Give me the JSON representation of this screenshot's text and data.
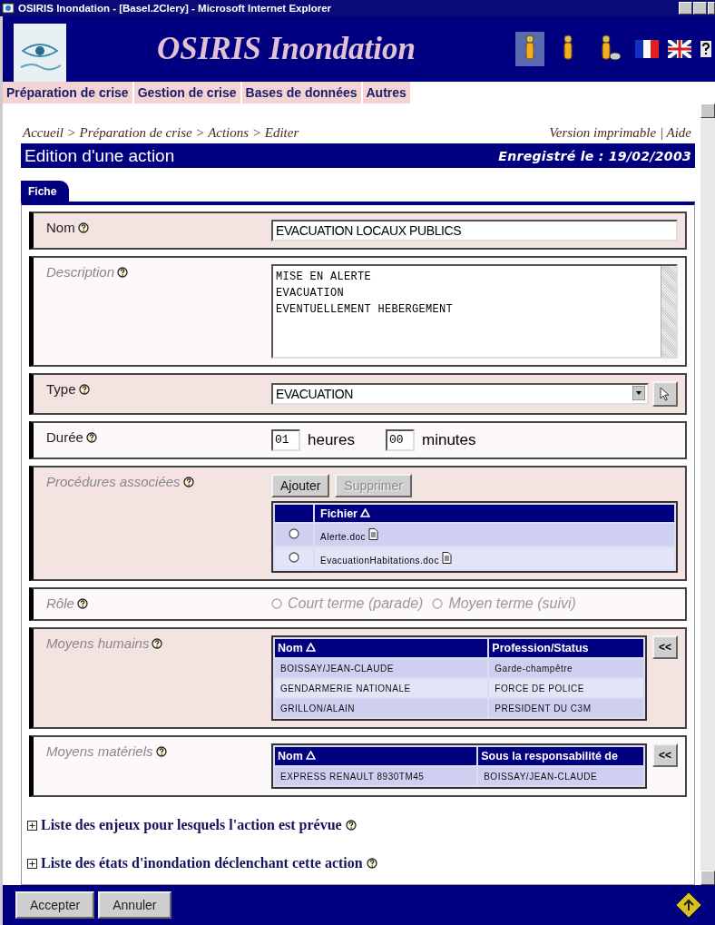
{
  "window": {
    "title": "OSIRIS Inondation - [Basel.2Clery] - Microsoft Internet Explorer"
  },
  "header": {
    "title": "OSIRIS Inondation",
    "user_icons": [
      {
        "selected": true
      },
      {
        "selected": false
      },
      {
        "selected": false
      }
    ]
  },
  "menu": [
    "Préparation de crise",
    "Gestion de crise",
    "Bases de données",
    "Autres"
  ],
  "breadcrumb": {
    "items": [
      "Accueil",
      "Préparation de crise",
      "Actions",
      "Editer"
    ],
    "separator": ">"
  },
  "page_links": {
    "items": [
      "Version imprimable",
      "Aide"
    ],
    "separator": "|"
  },
  "page_title": "Edition d'une action",
  "saved": "Enregistré le : 19/02/2003",
  "tabs": [
    {
      "label": "Fiche",
      "selected": true
    }
  ],
  "fields": [
    {
      "kind": "text",
      "label": "Nom",
      "required": true,
      "value": "EVACUATION LOCAUX PUBLICS"
    },
    {
      "kind": "textarea",
      "label": "Description",
      "required": false,
      "lines": [
        "MISE EN ALERTE",
        "EVACUATION",
        "EVENTUELLEMENT HEBERGEMENT"
      ]
    },
    {
      "kind": "select",
      "label": "Type",
      "required": true,
      "value": "EVACUATION"
    },
    {
      "kind": "duration",
      "label": "Durée",
      "required": true,
      "hours": "01",
      "hours_unit": "heures",
      "minutes": "00",
      "minutes_unit": "minutes"
    },
    {
      "kind": "files",
      "label": "Procédures associées",
      "required": false,
      "buttons": [
        {
          "label": "Ajouter",
          "disabled": false
        },
        {
          "label": "Supprimer",
          "disabled": true
        }
      ],
      "column": "Fichier",
      "files": [
        {
          "name": "Alerte.doc",
          "selected": false
        },
        {
          "name": "EvacuationHabitations.doc",
          "selected": false
        }
      ]
    },
    {
      "kind": "radio",
      "label": "Rôle",
      "required": false,
      "disabled": true,
      "options": [
        {
          "label": "Court terme (parade)",
          "selected": false
        },
        {
          "label": "Moyen terme (suivi)",
          "selected": false
        }
      ]
    },
    {
      "kind": "table",
      "label": "Moyens humains",
      "required": false,
      "columns": [
        "Nom",
        "Profession/Status"
      ],
      "rows": [
        [
          "BOISSAY/JEAN-CLAUDE",
          "Garde-champêtre"
        ],
        [
          "GENDARMERIE NATIONALE",
          "FORCE DE POLICE"
        ],
        [
          "GRILLON/ALAIN",
          "PRESIDENT DU C3M"
        ]
      ],
      "button": "<<"
    },
    {
      "kind": "table",
      "label": "Moyens matériels",
      "required": false,
      "columns": [
        "Nom",
        "Sous la responsabilité de"
      ],
      "rows": [
        [
          "EXPRESS RENAULT 8930TM45",
          "BOISSAY/JEAN-CLAUDE"
        ]
      ],
      "button": "<<"
    }
  ],
  "sections": [
    {
      "label": "Liste des enjeux pour lesquels l'action est prévue",
      "expanded": false
    },
    {
      "label": "Liste des états d'inondation déclenchant cette action",
      "expanded": false
    }
  ],
  "buttons": [
    "Accepter",
    "Annuler"
  ]
}
